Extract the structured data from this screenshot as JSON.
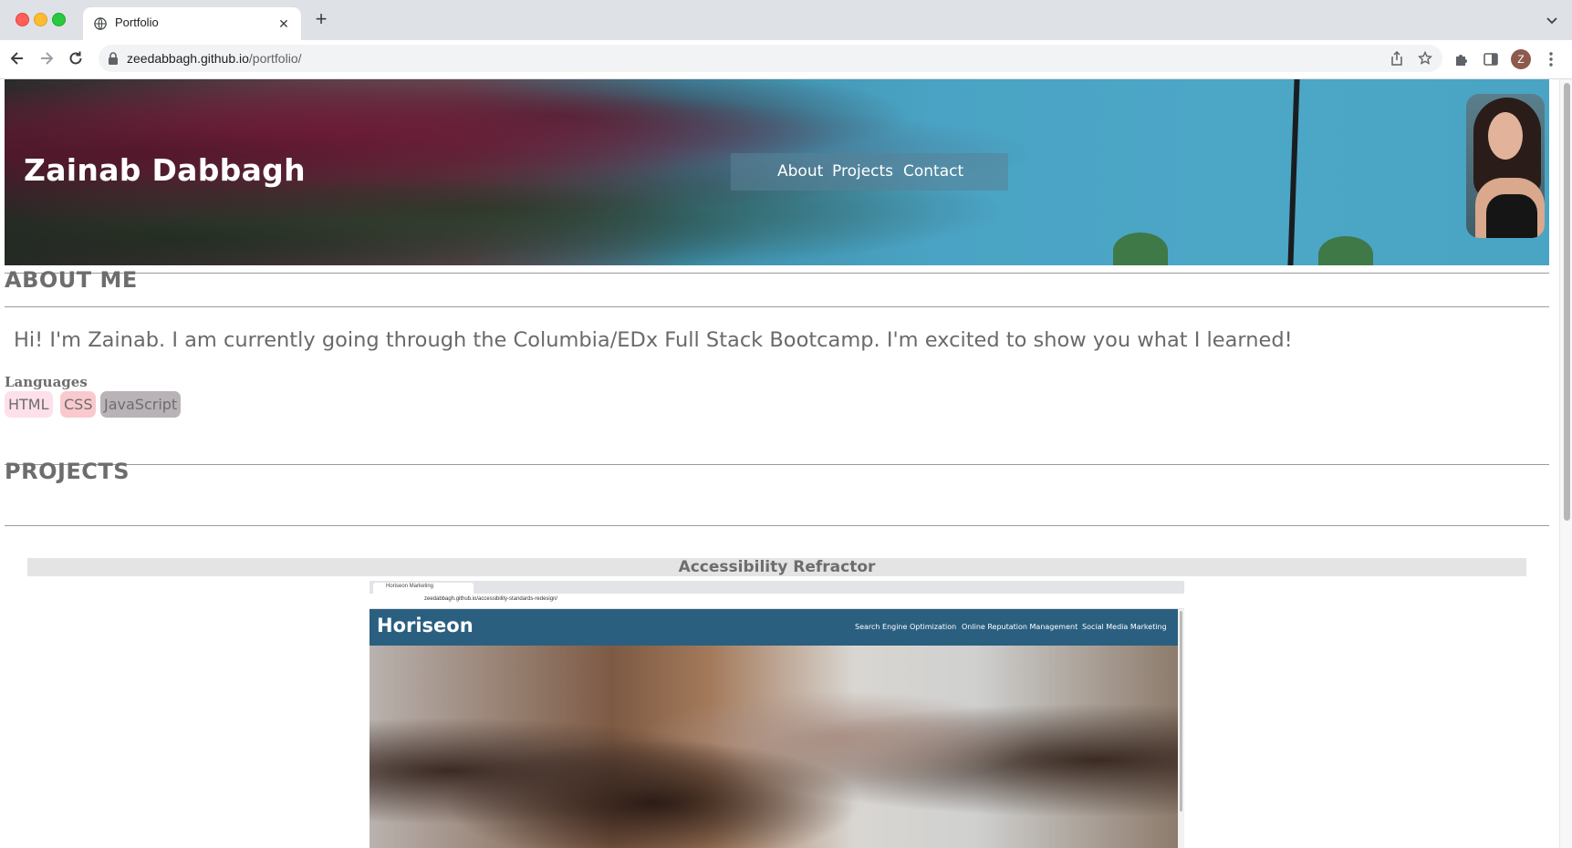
{
  "browser": {
    "tab": {
      "title": "Portfolio",
      "close": "✕"
    },
    "new_tab": "+",
    "address": {
      "domain": "zeedabbagh.github.io",
      "path": "/portfolio/"
    },
    "profile_initial": "Z"
  },
  "site": {
    "name": "Zainab Dabbagh",
    "nav": [
      {
        "label": "About"
      },
      {
        "label": "Projects"
      },
      {
        "label": "Contact"
      }
    ],
    "about": {
      "title": "ABOUT ME",
      "text": "Hi! I'm Zainab. I am currently going through the Columbia/EDx Full Stack Bootcamp. I'm excited to show you what I learned!",
      "languages_label": "Languages",
      "languages": [
        "HTML",
        "CSS",
        "JavaScript"
      ]
    },
    "projects": {
      "title": "PROJECTS",
      "items": [
        {
          "title": "Accessibility Refractor",
          "screenshot": {
            "tab_title": "Horiseon Marketing",
            "url": "zeedabbagh.github.io/accessibility-standards-redesign/",
            "logo": "Horiseon",
            "nav": [
              "Search Engine Optimization",
              "Online Reputation Management",
              "Social Media Marketing"
            ]
          }
        }
      ]
    }
  },
  "colors": {
    "chrome_bg": "#dee1e6",
    "heading_text": "#6d6d6d",
    "badge_html": "#fde0ea",
    "badge_css": "#f9c9cd",
    "badge_js": "#b9b3b8",
    "project_bar": "#e4e4e4",
    "horiseon_header": "#2a5f80"
  },
  "icons": [
    "globe-icon",
    "close-icon",
    "plus-icon",
    "chevron-down-icon",
    "back-arrow-icon",
    "forward-arrow-icon",
    "reload-icon",
    "lock-icon",
    "share-icon",
    "star-icon",
    "puzzle-icon",
    "side-panel-icon",
    "more-vert-icon"
  ]
}
